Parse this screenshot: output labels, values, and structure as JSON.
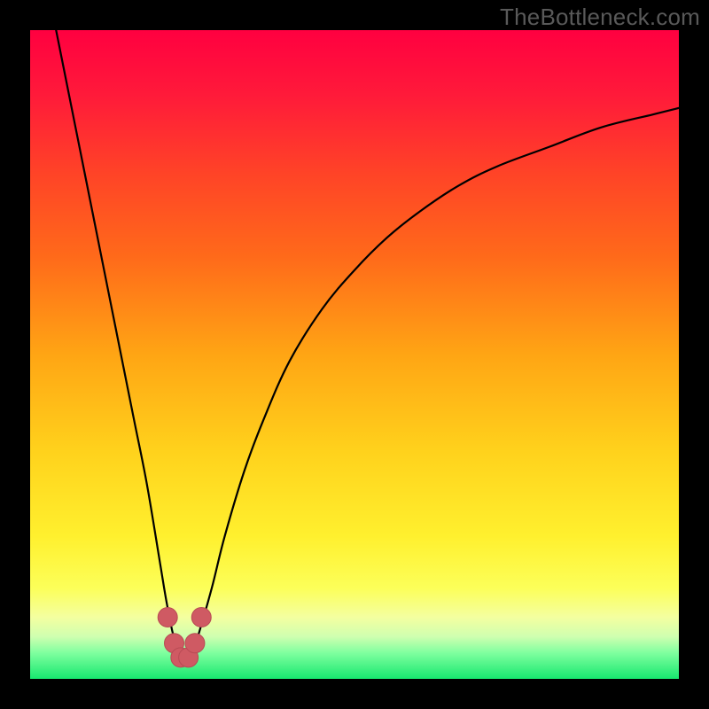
{
  "watermark": "TheBottleneck.com",
  "colors": {
    "frame": "#000000",
    "curve": "#000000",
    "marker_fill": "#cf5a63",
    "marker_stroke": "#b84b54",
    "gradient_stops": [
      {
        "offset": 0.0,
        "color": "#ff0040"
      },
      {
        "offset": 0.1,
        "color": "#ff1a3a"
      },
      {
        "offset": 0.22,
        "color": "#ff4327"
      },
      {
        "offset": 0.35,
        "color": "#ff6a1a"
      },
      {
        "offset": 0.5,
        "color": "#ffa514"
      },
      {
        "offset": 0.65,
        "color": "#ffd21c"
      },
      {
        "offset": 0.78,
        "color": "#fff02e"
      },
      {
        "offset": 0.86,
        "color": "#fcff59"
      },
      {
        "offset": 0.905,
        "color": "#f4ffa0"
      },
      {
        "offset": 0.935,
        "color": "#cfffb0"
      },
      {
        "offset": 0.96,
        "color": "#7fff9f"
      },
      {
        "offset": 1.0,
        "color": "#17e86f"
      }
    ]
  },
  "chart_data": {
    "type": "line",
    "title": "",
    "xlabel": "",
    "ylabel": "",
    "xlim": [
      0,
      100
    ],
    "ylim": [
      0,
      100
    ],
    "grid": false,
    "legend": false,
    "series": [
      {
        "name": "bottleneck-curve",
        "x": [
          4,
          6,
          8,
          10,
          12,
          14,
          16,
          18,
          20,
          21,
          22,
          23,
          24,
          25,
          26,
          28,
          30,
          33,
          36,
          40,
          45,
          50,
          55,
          60,
          66,
          72,
          80,
          88,
          96,
          100
        ],
        "y": [
          100,
          90,
          80,
          70,
          60,
          50,
          40,
          30,
          18,
          12,
          7,
          4,
          3,
          4,
          7,
          14,
          22,
          32,
          40,
          49,
          57,
          63,
          68,
          72,
          76,
          79,
          82,
          85,
          87,
          88
        ]
      }
    ],
    "markers": [
      {
        "x": 21.2,
        "y": 9.5
      },
      {
        "x": 22.2,
        "y": 5.5
      },
      {
        "x": 23.2,
        "y": 3.3
      },
      {
        "x": 24.4,
        "y": 3.3
      },
      {
        "x": 25.4,
        "y": 5.5
      },
      {
        "x": 26.4,
        "y": 9.5
      }
    ]
  }
}
